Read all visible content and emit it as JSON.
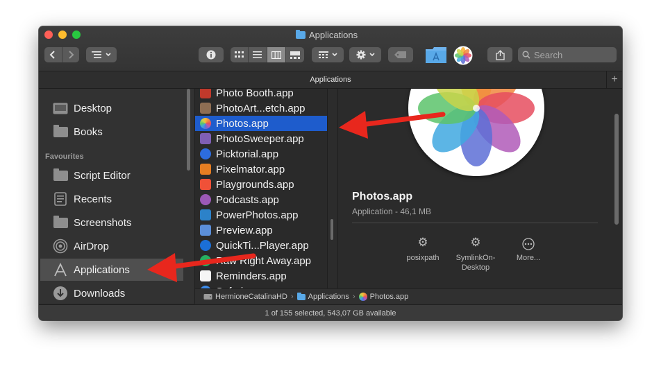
{
  "window": {
    "title": "Applications"
  },
  "toolbar": {
    "view_options": [
      "icon-view",
      "list-view",
      "column-view",
      "gallery-view"
    ],
    "active_view": "column-view",
    "search_placeholder": "Search"
  },
  "path_header": {
    "title": "Applications"
  },
  "sidebar": {
    "items_top": [
      {
        "label": "Desktop",
        "icon": "desktop-icon"
      },
      {
        "label": "Books",
        "icon": "folder-icon"
      }
    ],
    "section": "Favourites",
    "favourites": [
      {
        "label": "Script Editor",
        "icon": "folder-icon"
      },
      {
        "label": "Recents",
        "icon": "recents-icon"
      },
      {
        "label": "Screenshots",
        "icon": "folder-icon"
      },
      {
        "label": "AirDrop",
        "icon": "airdrop-icon"
      },
      {
        "label": "Applications",
        "icon": "applications-icon",
        "selected": true
      },
      {
        "label": "Downloads",
        "icon": "downloads-icon"
      }
    ]
  },
  "apps": [
    {
      "name": "Photo Booth.app",
      "color": "#c0392b"
    },
    {
      "name": "PhotoArt...etch.app",
      "color": "#8e6e53"
    },
    {
      "name": "Photos.app",
      "color": "#f1c40f",
      "selected": true
    },
    {
      "name": "PhotoSweeper.app",
      "color": "#7f5fb5"
    },
    {
      "name": "Picktorial.app",
      "color": "#2d6cdf"
    },
    {
      "name": "Pixelmator.app",
      "color": "#e67e22"
    },
    {
      "name": "Playgrounds.app",
      "color": "#f05138"
    },
    {
      "name": "Podcasts.app",
      "color": "#9b59b6"
    },
    {
      "name": "PowerPhotos.app",
      "color": "#2c82c9"
    },
    {
      "name": "Preview.app",
      "color": "#5b8fd9"
    },
    {
      "name": "QuickTi...Player.app",
      "color": "#1b6fd6"
    },
    {
      "name": "Raw Right Away.app",
      "color": "#27ae60"
    },
    {
      "name": "Reminders.app",
      "color": "#f5f5f5"
    },
    {
      "name": "Safari.app",
      "color": "#3d8be8"
    }
  ],
  "preview": {
    "name": "Photos.app",
    "kind": "Application - 46,1 MB",
    "actions": [
      {
        "label": "posixpath",
        "icon": "gear-icon"
      },
      {
        "label": "SymlinkOn-Desktop",
        "icon": "gear-icon"
      },
      {
        "label": "More...",
        "icon": "more-icon"
      }
    ]
  },
  "path_bar": {
    "crumbs": [
      "HermioneCatalinaHD",
      "Applications",
      "Photos.app"
    ]
  },
  "status_bar": {
    "text": "1 of 155 selected, 543,07 GB available"
  }
}
